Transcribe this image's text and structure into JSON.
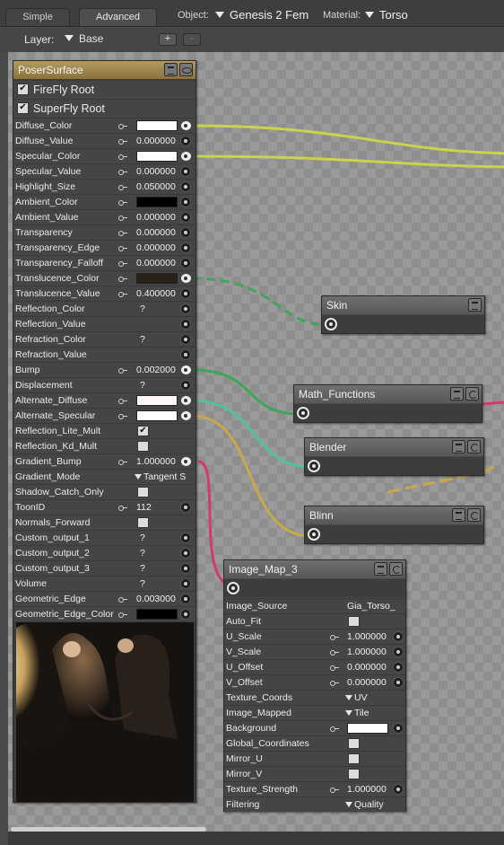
{
  "tabs": [
    {
      "label": "Simple"
    },
    {
      "label": "Advanced"
    }
  ],
  "object": {
    "label": "Object:",
    "value": "Genesis 2 Fem"
  },
  "material": {
    "label": "Material:",
    "value": "Torso"
  },
  "layer": {
    "label": "Layer:",
    "value": "Base",
    "add_label": "+",
    "remove_label": "-"
  },
  "root": {
    "title": "PoserSurface",
    "roots": [
      {
        "label": "FireFly Root",
        "checked": true
      },
      {
        "label": "SuperFly Root",
        "checked": true
      }
    ],
    "params": [
      {
        "name": "Diffuse_Color",
        "kind": "color",
        "color": "#ffffff",
        "socket": "color"
      },
      {
        "name": "Diffuse_Value",
        "kind": "num",
        "value": "0.000000"
      },
      {
        "name": "Specular_Color",
        "kind": "color",
        "color": "#ffffff",
        "socket": "color"
      },
      {
        "name": "Specular_Value",
        "kind": "num",
        "value": "0.000000"
      },
      {
        "name": "Highlight_Size",
        "kind": "num",
        "value": "0.050000"
      },
      {
        "name": "Ambient_Color",
        "kind": "color",
        "color": "#000000"
      },
      {
        "name": "Ambient_Value",
        "kind": "num",
        "value": "0.000000"
      },
      {
        "name": "Transparency",
        "kind": "num",
        "value": "0.000000"
      },
      {
        "name": "Transparency_Edge",
        "kind": "num",
        "value": "0.000000"
      },
      {
        "name": "Transparency_Falloff",
        "kind": "num",
        "value": "0.000000"
      },
      {
        "name": "Translucence_Color",
        "kind": "color",
        "color": "#2a2118",
        "socket": "color"
      },
      {
        "name": "Translucence_Value",
        "kind": "num",
        "value": "0.400000"
      },
      {
        "name": "Reflection_Color",
        "kind": "q",
        "value": "?"
      },
      {
        "name": "Reflection_Value",
        "kind": "none"
      },
      {
        "name": "Refraction_Color",
        "kind": "q",
        "value": "?"
      },
      {
        "name": "Refraction_Value",
        "kind": "none"
      },
      {
        "name": "Bump",
        "kind": "num",
        "value": "0.002000",
        "socket": "color"
      },
      {
        "name": "Displacement",
        "kind": "q",
        "value": "?"
      },
      {
        "name": "Alternate_Diffuse",
        "kind": "color",
        "color": "#fff8f6",
        "socket": "color"
      },
      {
        "name": "Alternate_Specular",
        "kind": "color",
        "color": "#ffffff",
        "socket": "color"
      },
      {
        "name": "Reflection_Lite_Mult",
        "kind": "check",
        "checked": true
      },
      {
        "name": "Reflection_Kd_Mult",
        "kind": "check",
        "checked": false
      },
      {
        "name": "Gradient_Bump",
        "kind": "num",
        "value": "1.000000",
        "socket": "color"
      },
      {
        "name": "Gradient_Mode",
        "kind": "dd",
        "value": "Tangent S"
      },
      {
        "name": "Shadow_Catch_Only",
        "kind": "check",
        "checked": false
      },
      {
        "name": "ToonID",
        "kind": "num",
        "value": "112"
      },
      {
        "name": "Normals_Forward",
        "kind": "check",
        "checked": false
      },
      {
        "name": "Custom_output_1",
        "kind": "q",
        "value": "?"
      },
      {
        "name": "Custom_output_2",
        "kind": "q",
        "value": "?"
      },
      {
        "name": "Custom_output_3",
        "kind": "q",
        "value": "?"
      },
      {
        "name": "Volume",
        "kind": "q",
        "value": "?"
      },
      {
        "name": "Geometric_Edge",
        "kind": "num",
        "value": "0.003000"
      },
      {
        "name": "Geometric_Edge_Color",
        "kind": "color",
        "color": "#000000"
      }
    ]
  },
  "nodes": [
    {
      "id": "skin",
      "title": "Skin",
      "buttons": [
        "list"
      ]
    },
    {
      "id": "math",
      "title": "Math_Functions",
      "buttons": [
        "list",
        "swap"
      ]
    },
    {
      "id": "blender",
      "title": "Blender",
      "buttons": [
        "list",
        "swap"
      ]
    },
    {
      "id": "blinn",
      "title": "Blinn",
      "buttons": [
        "list",
        "swap"
      ]
    }
  ],
  "image_map": {
    "title": "Image_Map_3",
    "params": [
      {
        "name": "Image_Source",
        "kind": "text",
        "value": "Gia_Torso_"
      },
      {
        "name": "Auto_Fit",
        "kind": "check",
        "checked": false
      },
      {
        "name": "U_Scale",
        "kind": "num",
        "value": "1.000000"
      },
      {
        "name": "V_Scale",
        "kind": "num",
        "value": "1.000000"
      },
      {
        "name": "U_Offset",
        "kind": "num",
        "value": "0.000000"
      },
      {
        "name": "V_Offset",
        "kind": "num",
        "value": "0.000000"
      },
      {
        "name": "Texture_Coords",
        "kind": "dd",
        "value": "UV"
      },
      {
        "name": "Image_Mapped",
        "kind": "dd",
        "value": "Tile"
      },
      {
        "name": "Background",
        "kind": "color",
        "color": "#ffffff"
      },
      {
        "name": "Global_Coordinates",
        "kind": "check",
        "checked": false
      },
      {
        "name": "Mirror_U",
        "kind": "check",
        "checked": false
      },
      {
        "name": "Mirror_V",
        "kind": "check",
        "checked": false
      },
      {
        "name": "Texture_Strength",
        "kind": "num",
        "value": "1.000000"
      },
      {
        "name": "Filtering",
        "kind": "dd",
        "value": "Quality"
      }
    ]
  },
  "wire_colors": {
    "diffuse": "#c8d44a",
    "specular": "#c8d44a",
    "translucence": "#3fa55a",
    "bump": "#3fa55a",
    "alt_diffuse": "#4fc29a",
    "alt_specular": "#c9a84a",
    "gradient": "#d23a6a",
    "blinn_out": "#c9a84a"
  }
}
